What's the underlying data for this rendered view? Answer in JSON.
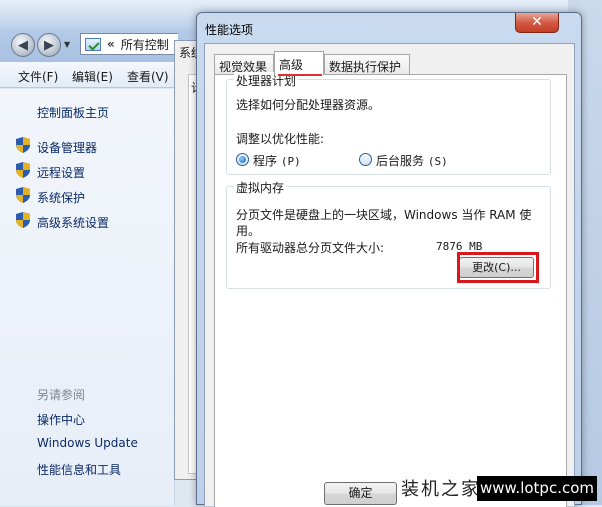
{
  "explorer": {
    "address_text": "所有控制",
    "address_chevron": "«",
    "menu": [
      "文件(F)",
      "编辑(E)",
      "查看(V)"
    ],
    "sidebar": {
      "home": "控制面板主页",
      "items": [
        "设备管理器",
        "远程设置",
        "系统保护",
        "高级系统设置"
      ],
      "see_also_title": "另请参阅",
      "see_also": [
        "操作中心",
        "Windows Update",
        "性能信息和工具"
      ]
    }
  },
  "system_window": {
    "title_fragment": "系统",
    "tab_fragment": "计"
  },
  "dialog": {
    "title": "性能选项",
    "close_glyph": "✕",
    "tabs": [
      "视觉效果",
      "高级",
      "数据执行保护"
    ],
    "active_tab": "高级",
    "processor": {
      "legend": "处理器计划",
      "description": "选择如何分配处理器资源。",
      "optimize_label": "调整以优化性能:",
      "options": [
        {
          "label": "程序",
          "key": "(P)",
          "selected": true
        },
        {
          "label": "后台服务",
          "key": "(S)",
          "selected": false
        }
      ]
    },
    "virtual_memory": {
      "legend": "虚拟内存",
      "description": "分页文件是硬盘上的一块区域，Windows 当作 RAM 使用。",
      "total_label": "所有驱动器总分页文件大小:",
      "total_value": "7876 MB",
      "change_button": "更改(C)..."
    },
    "ok_button": "确定"
  },
  "watermark": {
    "site_name": "装机之家",
    "url": "www.lotpc.com"
  },
  "colors": {
    "highlight": "#d8181b",
    "link": "#0c2a66"
  }
}
